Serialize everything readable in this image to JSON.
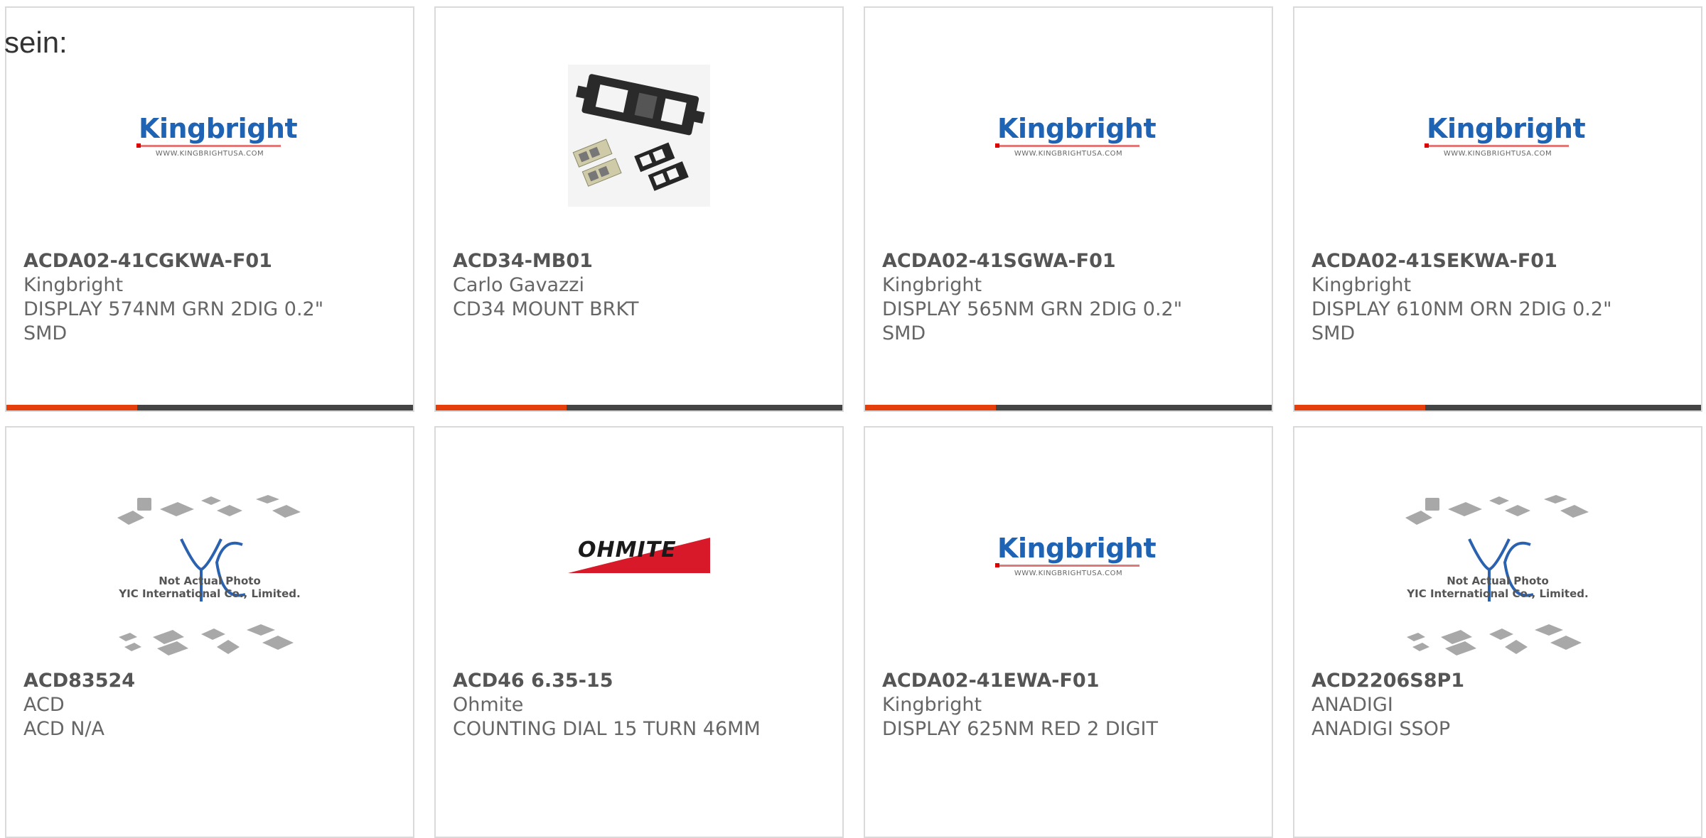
{
  "heading": "sein:",
  "products": [
    {
      "part": "ACDA02-41CGKWA-F01",
      "maker": "Kingbright",
      "desc_lines": [
        "DISPLAY 574NM GRN 2DIG 0.2\"",
        "SMD"
      ],
      "image": "kingbright-logo"
    },
    {
      "part": "ACD34-MB01",
      "maker": "Carlo Gavazzi",
      "desc_lines": [
        "CD34 MOUNT BRKT",
        ""
      ],
      "image": "bracket-photo"
    },
    {
      "part": "ACDA02-41SGWA-F01",
      "maker": "Kingbright",
      "desc_lines": [
        "DISPLAY 565NM GRN 2DIG 0.2\"",
        "SMD"
      ],
      "image": "kingbright-logo"
    },
    {
      "part": "ACDA02-41SEKWA-F01",
      "maker": "Kingbright",
      "desc_lines": [
        "DISPLAY 610NM ORN 2DIG 0.2\"",
        "SMD"
      ],
      "image": "kingbright-logo"
    },
    {
      "part": "ACD83524",
      "maker": "ACD",
      "desc_lines": [
        "ACD N/A",
        ""
      ],
      "image": "yic-placeholder"
    },
    {
      "part": "ACD46 6.35-15",
      "maker": "Ohmite",
      "desc_lines": [
        "COUNTING DIAL 15 TURN 46MM",
        ""
      ],
      "image": "ohmite-logo"
    },
    {
      "part": "ACDA02-41EWA-F01",
      "maker": "Kingbright",
      "desc_lines": [
        "DISPLAY 625NM RED 2 DIGIT",
        ""
      ],
      "image": "kingbright-logo"
    },
    {
      "part": "ACD2206S8P1",
      "maker": "ANADIGI",
      "desc_lines": [
        "ANADIGI SSOP",
        ""
      ],
      "image": "yic-placeholder"
    }
  ],
  "logos": {
    "kingbright_word": "Kingbright",
    "kingbright_url": "WWW.KINGBRIGHTUSA.COM",
    "ohmite_word": "OHMITE",
    "yic_line1": "Not Actual Photo",
    "yic_line2": "YIC International Co., Limited."
  },
  "colors": {
    "accent": "#e5400b",
    "bar": "#444444",
    "kingbright_blue": "#1f63b4",
    "card_border": "#dadada"
  }
}
